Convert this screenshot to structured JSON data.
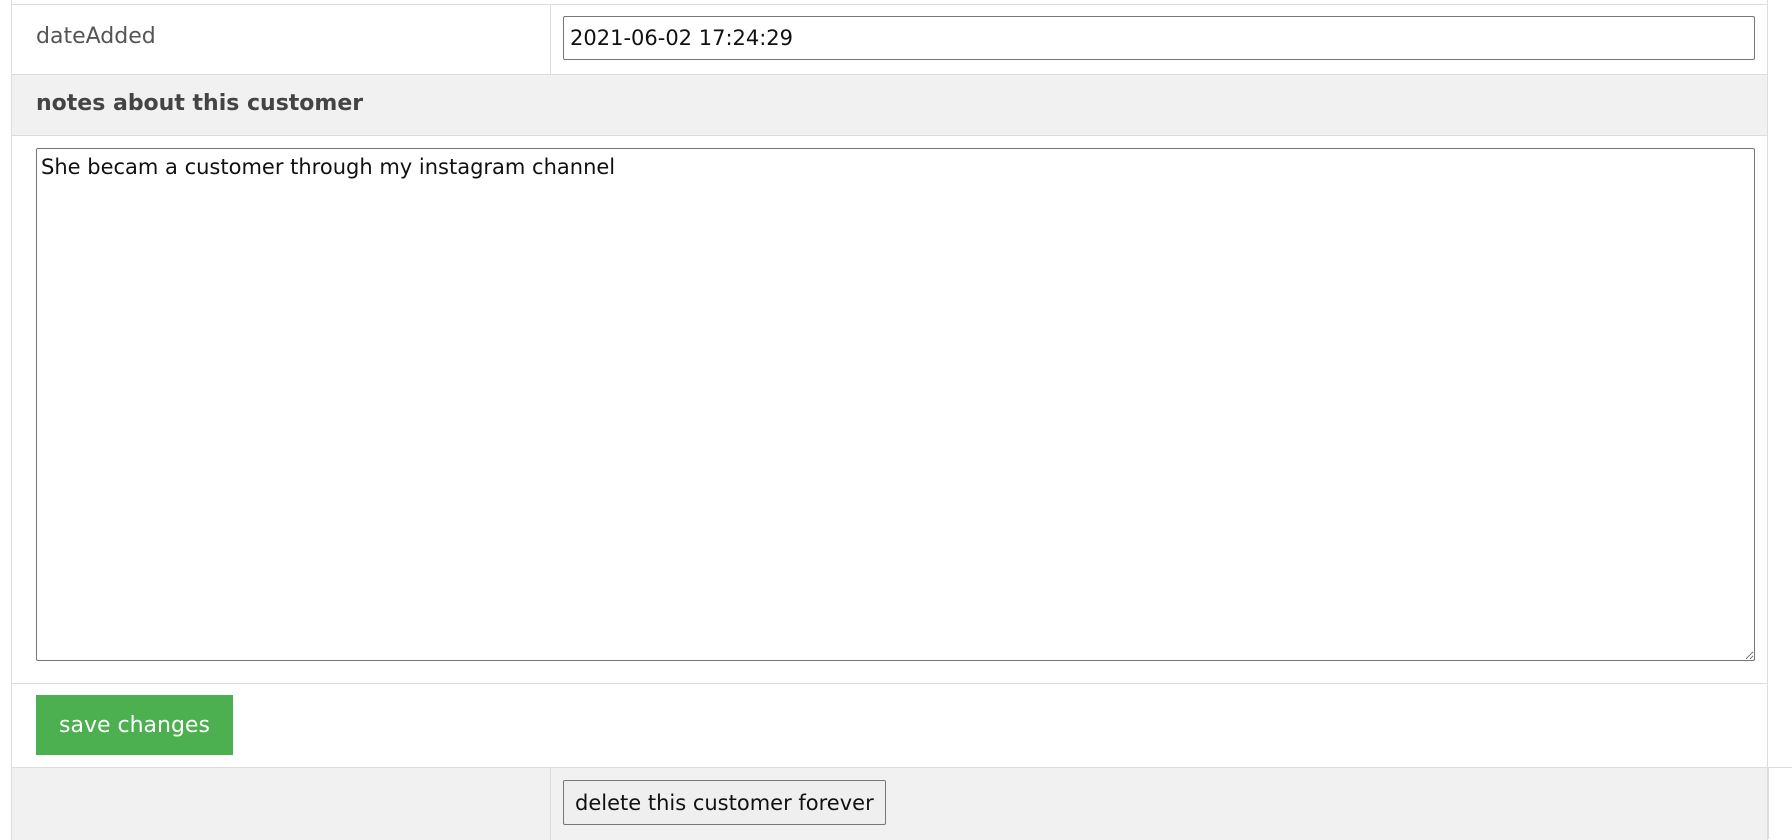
{
  "fields": {
    "date_added": {
      "label": "dateAdded",
      "value": "2021-06-02 17:24:29"
    }
  },
  "notes": {
    "heading": "notes about this customer",
    "value": "She becam a customer through my instagram channel"
  },
  "actions": {
    "save_label": "save changes",
    "delete_label": "delete this customer forever"
  },
  "colors": {
    "save_button_bg": "#4caf50",
    "heading_row_bg": "#f1f1f1"
  }
}
